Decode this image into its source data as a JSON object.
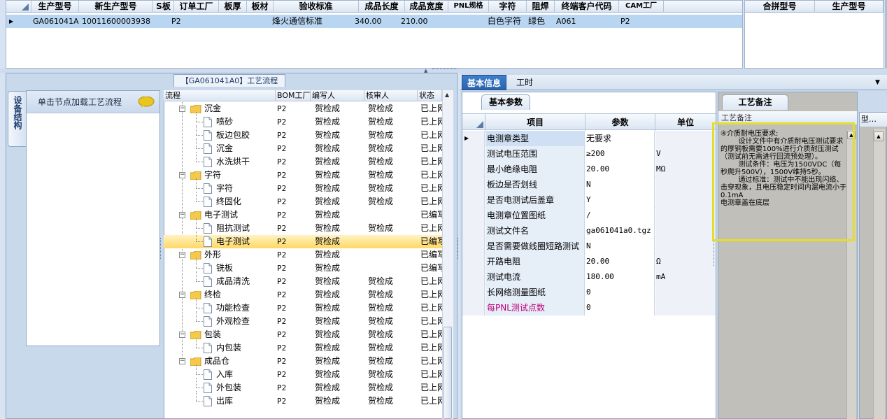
{
  "top_grid": {
    "columns": [
      "生产型号",
      "新生产型号",
      "S板",
      "订单工厂",
      "板厚",
      "板材",
      "验收标准",
      "成品长度",
      "成品宽度",
      "PNL规格",
      "字符",
      "阻焊",
      "终端客户代码",
      "CAM工厂"
    ],
    "row": {
      "production_model": "GA061041A0",
      "new_production_model": "10011600003938",
      "s_board": "",
      "order_factory": "P2",
      "thickness": "",
      "material": "",
      "acceptance_standard": "烽火通信标准",
      "length": "340.00",
      "width": "210.00",
      "pnl_spec": "",
      "character": "白色字符",
      "solder_mask": "绿色",
      "customer_code": "A061",
      "cam_factory": "P2"
    }
  },
  "right_grid": {
    "columns": [
      "合拼型号",
      "生产型号"
    ]
  },
  "process_panel": {
    "title": "【GA061041A0】工艺流程",
    "side_tab": "设备结构",
    "loader_text": "单击节点加载工艺流程"
  },
  "tree": {
    "columns": [
      "流程",
      "BOM工厂",
      "编写人",
      "核审人",
      "状态"
    ],
    "rows": [
      {
        "label": "沉金",
        "type": "folder",
        "bom": "P2",
        "writer": "贺检成",
        "reviewer": "贺检成",
        "status": "已上网"
      },
      {
        "label": "喷砂",
        "type": "doc",
        "bom": "P2",
        "writer": "贺检成",
        "reviewer": "贺检成",
        "status": "已上网"
      },
      {
        "label": "板边包胶",
        "type": "doc",
        "bom": "P2",
        "writer": "贺检成",
        "reviewer": "贺检成",
        "status": "已上网"
      },
      {
        "label": "沉金",
        "type": "doc",
        "bom": "P2",
        "writer": "贺检成",
        "reviewer": "贺检成",
        "status": "已上网"
      },
      {
        "label": "水洗烘干",
        "type": "doc",
        "bom": "P2",
        "writer": "贺检成",
        "reviewer": "贺检成",
        "status": "已上网"
      },
      {
        "label": "字符",
        "type": "folder",
        "bom": "P2",
        "writer": "贺检成",
        "reviewer": "贺检成",
        "status": "已上网"
      },
      {
        "label": "字符",
        "type": "doc",
        "bom": "P2",
        "writer": "贺检成",
        "reviewer": "贺检成",
        "status": "已上网"
      },
      {
        "label": "终固化",
        "type": "doc",
        "bom": "P2",
        "writer": "贺检成",
        "reviewer": "贺检成",
        "status": "已上网"
      },
      {
        "label": "电子测试",
        "type": "folder",
        "bom": "P2",
        "writer": "贺检成",
        "reviewer": "",
        "status": "已编写"
      },
      {
        "label": "阻抗测试",
        "type": "doc",
        "bom": "P2",
        "writer": "贺检成",
        "reviewer": "贺检成",
        "status": "已上网"
      },
      {
        "label": "电子测试",
        "type": "doc",
        "bom": "P2",
        "writer": "贺检成",
        "reviewer": "",
        "status": "已编写",
        "selected": true
      },
      {
        "label": "外形",
        "type": "folder",
        "bom": "P2",
        "writer": "贺检成",
        "reviewer": "",
        "status": "已编写"
      },
      {
        "label": "铣板",
        "type": "doc",
        "bom": "P2",
        "writer": "贺检成",
        "reviewer": "",
        "status": "已编写"
      },
      {
        "label": "成品清洗",
        "type": "doc",
        "bom": "P2",
        "writer": "贺检成",
        "reviewer": "贺检成",
        "status": "已上网"
      },
      {
        "label": "终检",
        "type": "folder",
        "bom": "P2",
        "writer": "贺检成",
        "reviewer": "贺检成",
        "status": "已上网"
      },
      {
        "label": "功能检查",
        "type": "doc",
        "bom": "P2",
        "writer": "贺检成",
        "reviewer": "贺检成",
        "status": "已上网"
      },
      {
        "label": "外观检查",
        "type": "doc",
        "bom": "P2",
        "writer": "贺检成",
        "reviewer": "贺检成",
        "status": "已上网"
      },
      {
        "label": "包装",
        "type": "folder",
        "bom": "P2",
        "writer": "贺检成",
        "reviewer": "贺检成",
        "status": "已上网"
      },
      {
        "label": "内包装",
        "type": "doc",
        "bom": "P2",
        "writer": "贺检成",
        "reviewer": "贺检成",
        "status": "已上网"
      },
      {
        "label": "成品仓",
        "type": "folder",
        "bom": "P2",
        "writer": "贺检成",
        "reviewer": "贺检成",
        "status": "已上网"
      },
      {
        "label": "入库",
        "type": "doc",
        "bom": "P2",
        "writer": "贺检成",
        "reviewer": "贺检成",
        "status": "已上网"
      },
      {
        "label": "外包装",
        "type": "doc",
        "bom": "P2",
        "writer": "贺检成",
        "reviewer": "贺检成",
        "status": "已上网"
      },
      {
        "label": "出库",
        "type": "doc",
        "bom": "P2",
        "writer": "贺检成",
        "reviewer": "贺检成",
        "status": "已上网"
      }
    ]
  },
  "tabs": {
    "basic_info": "基本信息",
    "work_hours": "工时"
  },
  "params": {
    "tab": "基本参数",
    "columns": [
      "项目",
      "参数",
      "单位"
    ],
    "rows": [
      {
        "item": "电测章类型",
        "value": "无要求",
        "unit": ""
      },
      {
        "item": "测试电压范围",
        "value": "≥200",
        "unit": "V"
      },
      {
        "item": "最小绝缘电阻",
        "value": "20.00",
        "unit": "MΩ"
      },
      {
        "item": "板边是否划线",
        "value": "N",
        "unit": ""
      },
      {
        "item": "是否电测试后盖章",
        "value": "Y",
        "unit": ""
      },
      {
        "item": "电测章位置图纸",
        "value": "/",
        "unit": ""
      },
      {
        "item": "测试文件名",
        "value": "ga061041a0.tgz",
        "unit": ""
      },
      {
        "item": "是否需要做线圈短路测试",
        "value": "N",
        "unit": ""
      },
      {
        "item": "开路电阻",
        "value": "20.00",
        "unit": "Ω"
      },
      {
        "item": "测试电流",
        "value": "180.00",
        "unit": "mA"
      },
      {
        "item": "长网络测量图纸",
        "value": "0",
        "unit": ""
      },
      {
        "item": "每PNL测试点数",
        "value": "0",
        "unit": "",
        "highlight": true
      }
    ]
  },
  "notes": {
    "tab": "工艺备注",
    "header": "工艺备注",
    "text": "④介质耐电压要求:\n        设计文件中有介质耐电压测试要求的厚铜板需要100%进行介质耐压测试（测试前无需进行回流预处理）。\n        测试条件：电压为1500VDC（每秒爬升500V），1500V维持5秒。\n        通过标准：测试中不能出现闪络、击穿现象，且电压稳定时间内漏电流小于0.1mA\n电测章盖在底层"
  },
  "mini_grid": {
    "header": "型…"
  }
}
